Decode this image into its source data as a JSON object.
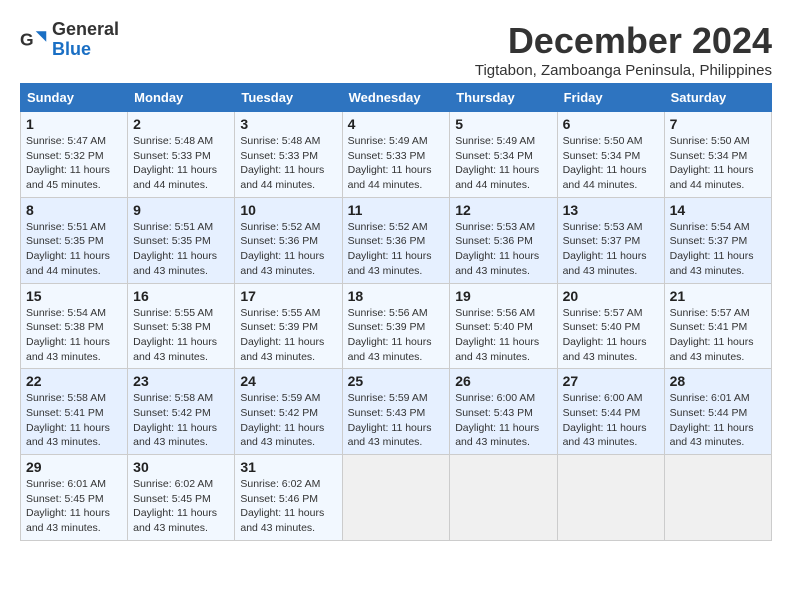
{
  "header": {
    "logo_general": "General",
    "logo_blue": "Blue",
    "month_title": "December 2024",
    "location": "Tigtabon, Zamboanga Peninsula, Philippines"
  },
  "weekdays": [
    "Sunday",
    "Monday",
    "Tuesday",
    "Wednesday",
    "Thursday",
    "Friday",
    "Saturday"
  ],
  "weeks": [
    [
      {
        "day": "1",
        "sunrise": "5:47 AM",
        "sunset": "5:32 PM",
        "daylight": "11 hours and 45 minutes."
      },
      {
        "day": "2",
        "sunrise": "5:48 AM",
        "sunset": "5:33 PM",
        "daylight": "11 hours and 44 minutes."
      },
      {
        "day": "3",
        "sunrise": "5:48 AM",
        "sunset": "5:33 PM",
        "daylight": "11 hours and 44 minutes."
      },
      {
        "day": "4",
        "sunrise": "5:49 AM",
        "sunset": "5:33 PM",
        "daylight": "11 hours and 44 minutes."
      },
      {
        "day": "5",
        "sunrise": "5:49 AM",
        "sunset": "5:34 PM",
        "daylight": "11 hours and 44 minutes."
      },
      {
        "day": "6",
        "sunrise": "5:50 AM",
        "sunset": "5:34 PM",
        "daylight": "11 hours and 44 minutes."
      },
      {
        "day": "7",
        "sunrise": "5:50 AM",
        "sunset": "5:34 PM",
        "daylight": "11 hours and 44 minutes."
      }
    ],
    [
      {
        "day": "8",
        "sunrise": "5:51 AM",
        "sunset": "5:35 PM",
        "daylight": "11 hours and 44 minutes."
      },
      {
        "day": "9",
        "sunrise": "5:51 AM",
        "sunset": "5:35 PM",
        "daylight": "11 hours and 43 minutes."
      },
      {
        "day": "10",
        "sunrise": "5:52 AM",
        "sunset": "5:36 PM",
        "daylight": "11 hours and 43 minutes."
      },
      {
        "day": "11",
        "sunrise": "5:52 AM",
        "sunset": "5:36 PM",
        "daylight": "11 hours and 43 minutes."
      },
      {
        "day": "12",
        "sunrise": "5:53 AM",
        "sunset": "5:36 PM",
        "daylight": "11 hours and 43 minutes."
      },
      {
        "day": "13",
        "sunrise": "5:53 AM",
        "sunset": "5:37 PM",
        "daylight": "11 hours and 43 minutes."
      },
      {
        "day": "14",
        "sunrise": "5:54 AM",
        "sunset": "5:37 PM",
        "daylight": "11 hours and 43 minutes."
      }
    ],
    [
      {
        "day": "15",
        "sunrise": "5:54 AM",
        "sunset": "5:38 PM",
        "daylight": "11 hours and 43 minutes."
      },
      {
        "day": "16",
        "sunrise": "5:55 AM",
        "sunset": "5:38 PM",
        "daylight": "11 hours and 43 minutes."
      },
      {
        "day": "17",
        "sunrise": "5:55 AM",
        "sunset": "5:39 PM",
        "daylight": "11 hours and 43 minutes."
      },
      {
        "day": "18",
        "sunrise": "5:56 AM",
        "sunset": "5:39 PM",
        "daylight": "11 hours and 43 minutes."
      },
      {
        "day": "19",
        "sunrise": "5:56 AM",
        "sunset": "5:40 PM",
        "daylight": "11 hours and 43 minutes."
      },
      {
        "day": "20",
        "sunrise": "5:57 AM",
        "sunset": "5:40 PM",
        "daylight": "11 hours and 43 minutes."
      },
      {
        "day": "21",
        "sunrise": "5:57 AM",
        "sunset": "5:41 PM",
        "daylight": "11 hours and 43 minutes."
      }
    ],
    [
      {
        "day": "22",
        "sunrise": "5:58 AM",
        "sunset": "5:41 PM",
        "daylight": "11 hours and 43 minutes."
      },
      {
        "day": "23",
        "sunrise": "5:58 AM",
        "sunset": "5:42 PM",
        "daylight": "11 hours and 43 minutes."
      },
      {
        "day": "24",
        "sunrise": "5:59 AM",
        "sunset": "5:42 PM",
        "daylight": "11 hours and 43 minutes."
      },
      {
        "day": "25",
        "sunrise": "5:59 AM",
        "sunset": "5:43 PM",
        "daylight": "11 hours and 43 minutes."
      },
      {
        "day": "26",
        "sunrise": "6:00 AM",
        "sunset": "5:43 PM",
        "daylight": "11 hours and 43 minutes."
      },
      {
        "day": "27",
        "sunrise": "6:00 AM",
        "sunset": "5:44 PM",
        "daylight": "11 hours and 43 minutes."
      },
      {
        "day": "28",
        "sunrise": "6:01 AM",
        "sunset": "5:44 PM",
        "daylight": "11 hours and 43 minutes."
      }
    ],
    [
      {
        "day": "29",
        "sunrise": "6:01 AM",
        "sunset": "5:45 PM",
        "daylight": "11 hours and 43 minutes."
      },
      {
        "day": "30",
        "sunrise": "6:02 AM",
        "sunset": "5:45 PM",
        "daylight": "11 hours and 43 minutes."
      },
      {
        "day": "31",
        "sunrise": "6:02 AM",
        "sunset": "5:46 PM",
        "daylight": "11 hours and 43 minutes."
      },
      null,
      null,
      null,
      null
    ]
  ],
  "labels": {
    "sunrise": "Sunrise:",
    "sunset": "Sunset:",
    "daylight": "Daylight:"
  }
}
